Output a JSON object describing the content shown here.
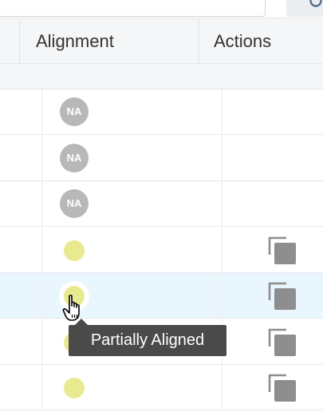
{
  "table": {
    "columns": {
      "alignment": "Alignment",
      "actions": "Actions"
    },
    "rows": [
      {
        "alignment_badge": "NA",
        "alignment_status": "not-applicable",
        "has_copy_action": false
      },
      {
        "alignment_badge": "NA",
        "alignment_status": "not-applicable",
        "has_copy_action": false
      },
      {
        "alignment_badge": "NA",
        "alignment_status": "not-applicable",
        "has_copy_action": false
      },
      {
        "alignment_badge": "",
        "alignment_status": "partially-aligned",
        "has_copy_action": true
      },
      {
        "alignment_badge": "",
        "alignment_status": "partially-aligned",
        "has_copy_action": true,
        "hovered": true
      },
      {
        "alignment_badge": "",
        "alignment_status": "partially-aligned",
        "has_copy_action": true
      },
      {
        "alignment_badge": "",
        "alignment_status": "partially-aligned",
        "has_copy_action": true
      }
    ]
  },
  "tooltip": {
    "text": "Partially Aligned"
  },
  "icons": {
    "search": "search-icon",
    "copy": "copy-icon",
    "cursor": "hand-pointer-cursor-icon"
  },
  "colors": {
    "header_bg": "#f5f6f7",
    "hover_row_bg": "#e9f6fd",
    "na_badge": "#b8b8b8",
    "partial_dot": "#e9e98f",
    "copy_icon": "#8e8e8e",
    "tooltip_bg": "#4a4a4a"
  }
}
